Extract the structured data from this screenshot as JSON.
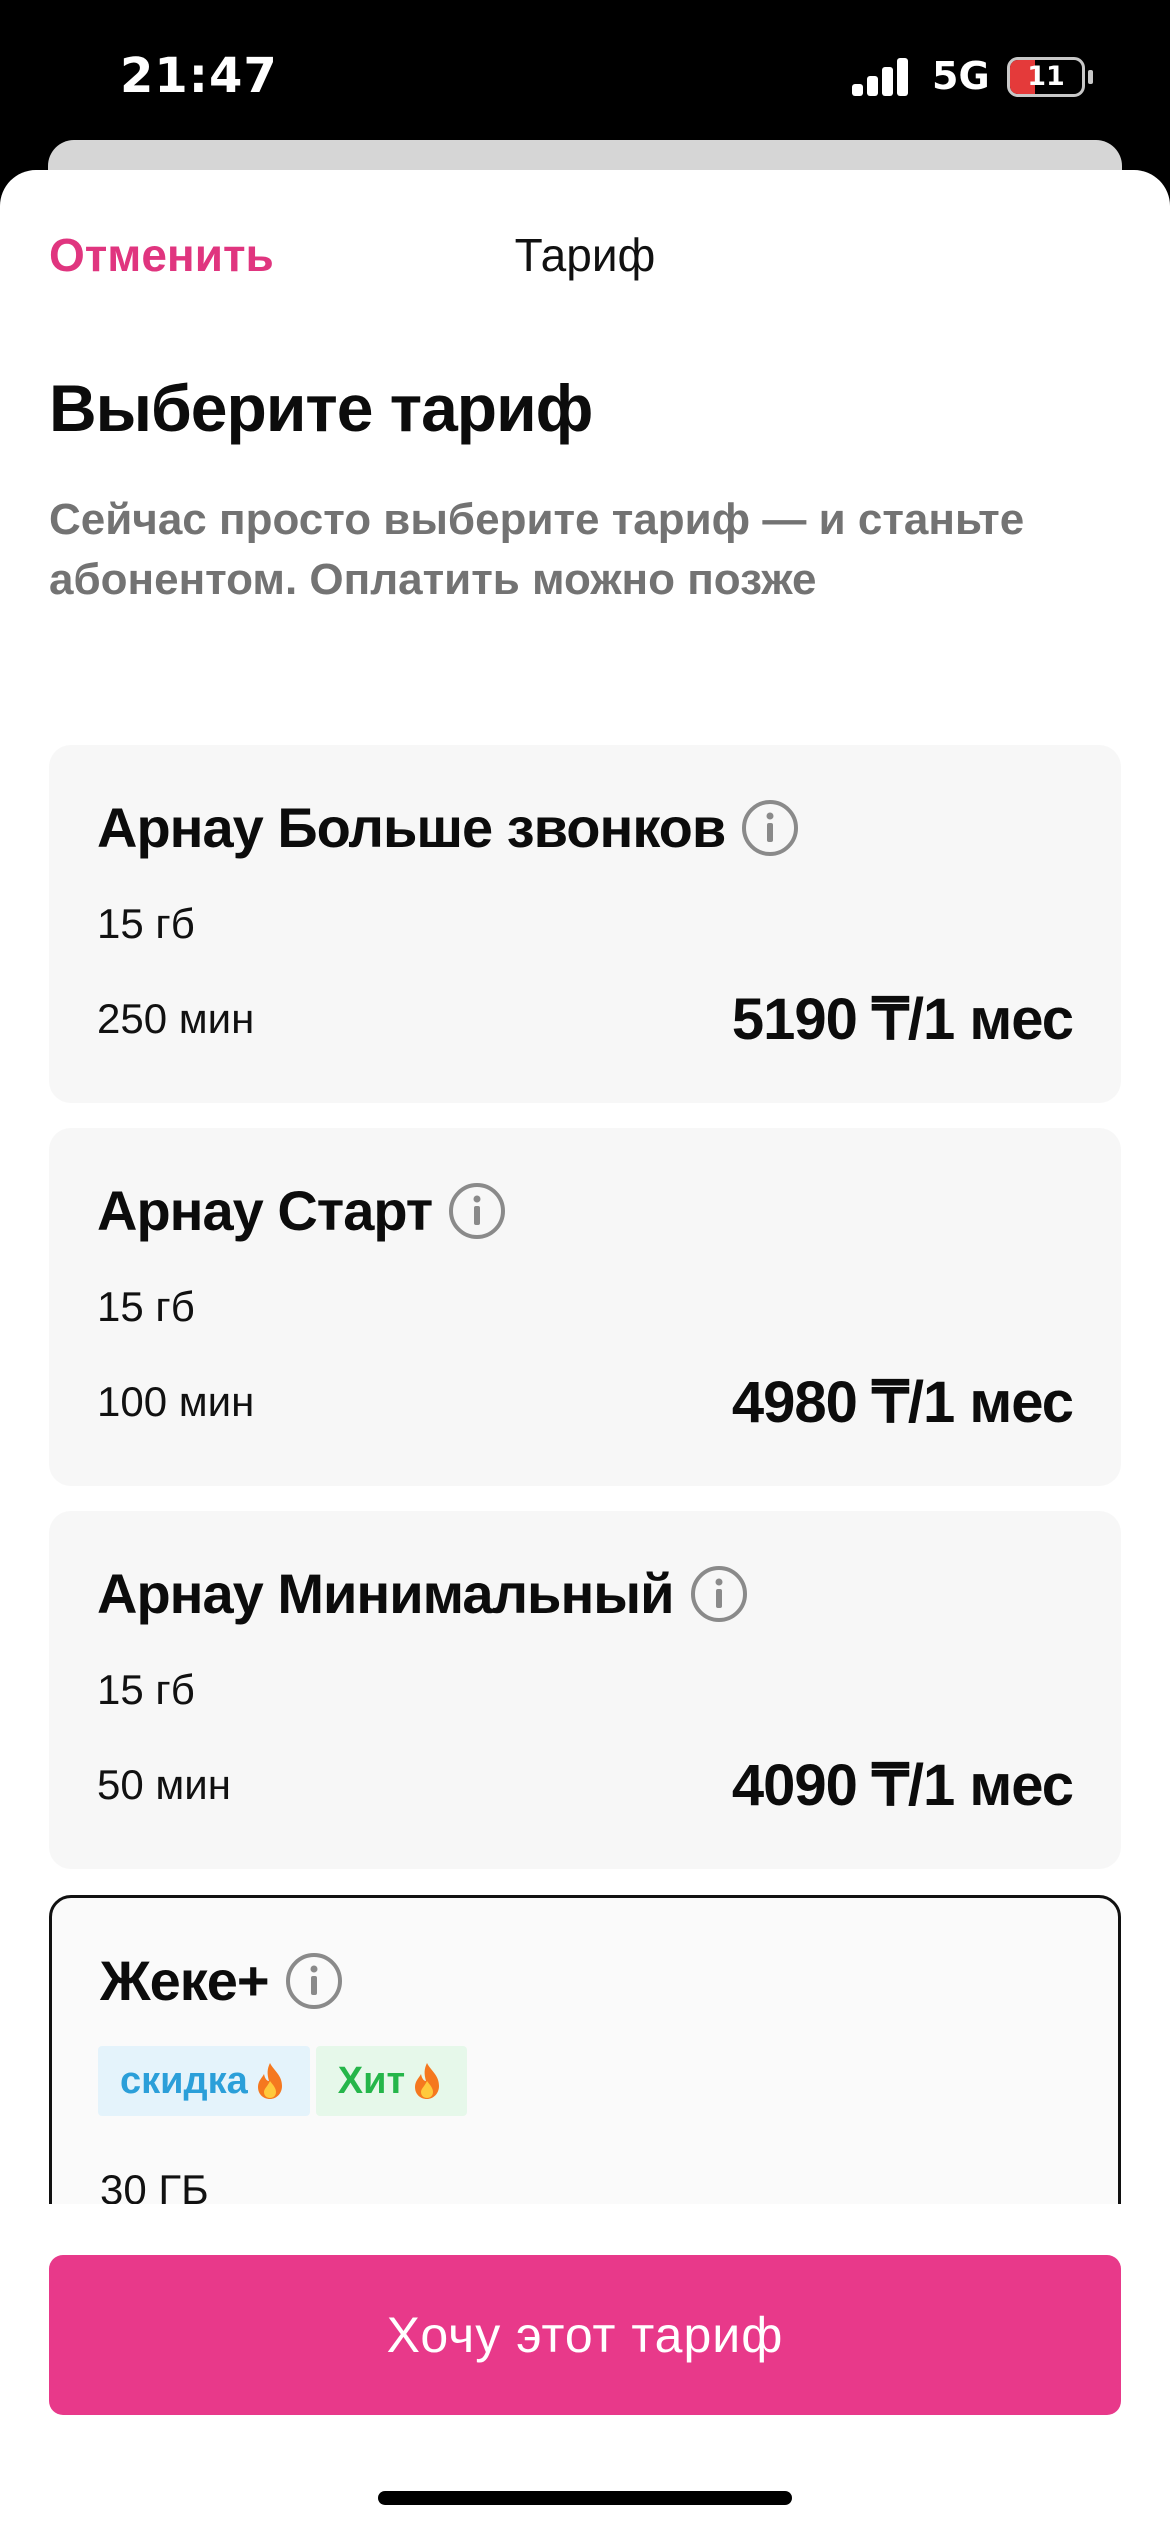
{
  "status_bar": {
    "time": "21:47",
    "network": "5G",
    "battery": "11",
    "battery_level": 0.11
  },
  "nav": {
    "cancel": "Отменить",
    "title": "Тариф"
  },
  "heading": "Выберите тариф",
  "subtitle": "Сейчас просто выберите тариф — и станьте абонентом. Оплатить можно позже",
  "tariffs": [
    {
      "name": "Арнау Больше звонков",
      "data": "15 гб",
      "minutes": "250 мин",
      "price": "5190 ₸/1 мес"
    },
    {
      "name": "Арнау Старт",
      "data": "15 гб",
      "minutes": "100 мин",
      "price": "4980 ₸/1 мес"
    },
    {
      "name": "Арнау Минимальный",
      "data": "15 гб",
      "minutes": "50 мин",
      "price": "4090 ₸/1 мес"
    },
    {
      "name": "Жеке+",
      "badges": [
        "скидка",
        "Хит"
      ],
      "data": "30 ГБ",
      "selected": true
    }
  ],
  "cta": {
    "label": "Хочу этот тариф"
  },
  "colors": {
    "accent": "#e8398a",
    "cancel": "#e0357f",
    "badge_blue": "#2b9fd9",
    "badge_green": "#25b64a"
  },
  "icons": {
    "info": "info-circle-icon",
    "flame": "fire-emoji-icon"
  }
}
